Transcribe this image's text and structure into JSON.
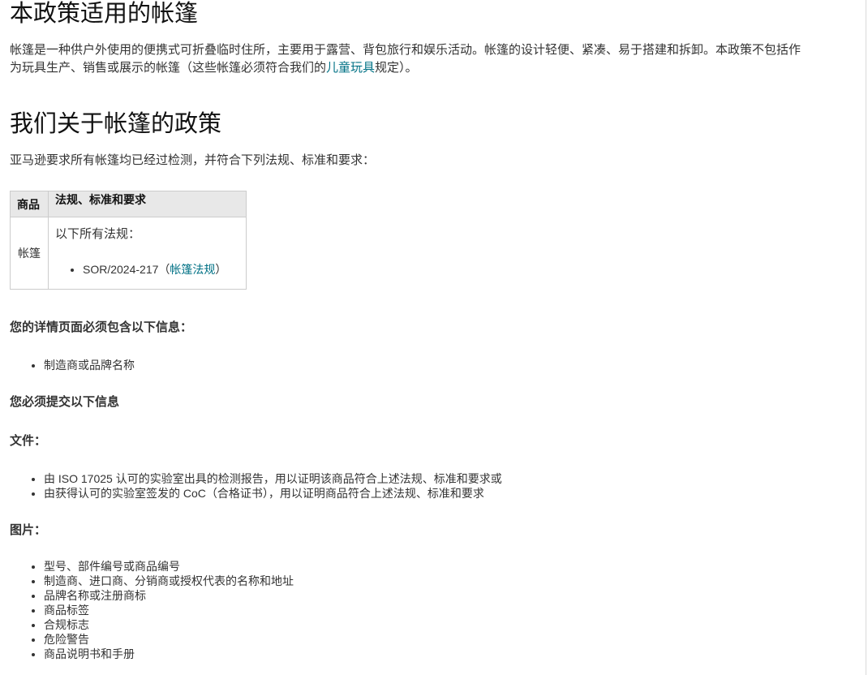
{
  "heading_scope": "本政策适用的帐篷",
  "intro": {
    "before": "帐篷是一种供户外使用的便携式可折叠临时住所，主要用于露营、背包旅行和娱乐活动。帐篷的设计轻便、紧凑、易于搭建和拆卸。本政策不包括作为玩具生产、销售或展示的帐篷（这些帐篷必须符合我们的",
    "link": "儿童玩具",
    "after": "规定）。"
  },
  "heading_policy": "我们关于帐篷的政策",
  "requirement_intro": "亚马逊要求所有帐篷均已经过检测，并符合下列法规、标准和要求：",
  "table": {
    "headers": [
      "商品",
      "法规、标准和要求"
    ],
    "product": "帐篷",
    "rule_intro": "以下所有法规：",
    "rule_item_code": "SOR/2024-217（",
    "rule_item_link": "帐篷法规",
    "rule_item_close": "）"
  },
  "detail_page": {
    "label": "您的详情页面必须包含以下信息：",
    "items": [
      "制造商或品牌名称"
    ]
  },
  "submit_label": "您必须提交以下信息",
  "documents": {
    "label": "文件：",
    "items": [
      "由 ISO 17025 认可的实验室出具的检测报告，用以证明该商品符合上述法规、标准和要求或",
      "由获得认可的实验室签发的 CoC（合格证书），用以证明商品符合上述法规、标准和要求"
    ]
  },
  "images": {
    "label": "图片：",
    "items": [
      "型号、部件编号或商品编号",
      "制造商、进口商、分销商或授权代表的名称和地址",
      "品牌名称或注册商标",
      "商品标签",
      "合规标志",
      "危险警告",
      "商品说明书和手册"
    ]
  }
}
